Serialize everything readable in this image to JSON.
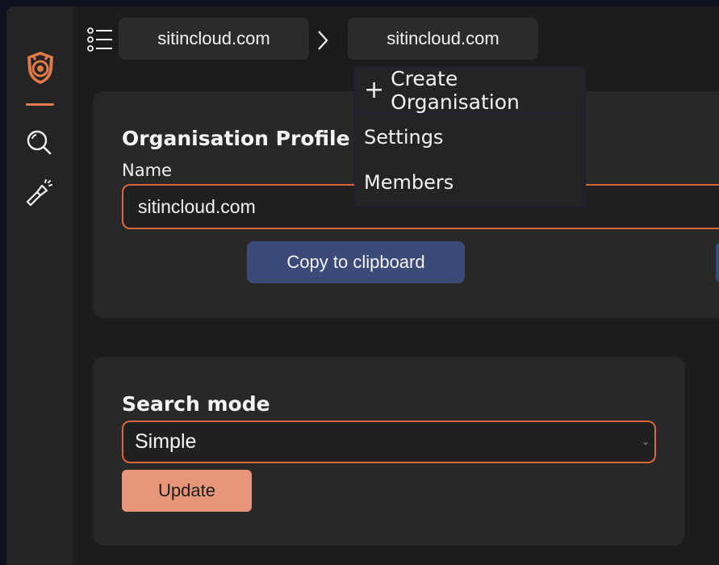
{
  "colors": {
    "accent": "#e07a48",
    "primary_button": "#3c4a78",
    "update_button": "#e8967a",
    "card": "#282829",
    "sidebar": "#242426"
  },
  "sidebar": {
    "logo_icon": "shield-logo-icon",
    "items": [
      {
        "icon": "search-icon"
      },
      {
        "icon": "flashlight-icon"
      }
    ]
  },
  "breadcrumb": {
    "menu_icon": "list-menu-icon",
    "items": [
      {
        "label": "sitincloud.com"
      },
      {
        "label": "sitincloud.com"
      }
    ],
    "separator_icon": "chevron-right-icon"
  },
  "org_dropdown": {
    "create_label": "Create Organisation",
    "items": [
      {
        "label": "Settings"
      },
      {
        "label": "Members"
      }
    ]
  },
  "profile": {
    "title": "Organisation Profile",
    "name_label": "Name",
    "name_value": "sitincloud.com",
    "copy_label": "Copy to clipboard"
  },
  "search_mode": {
    "title": "Search mode",
    "selected": "Simple",
    "update_label": "Update"
  }
}
